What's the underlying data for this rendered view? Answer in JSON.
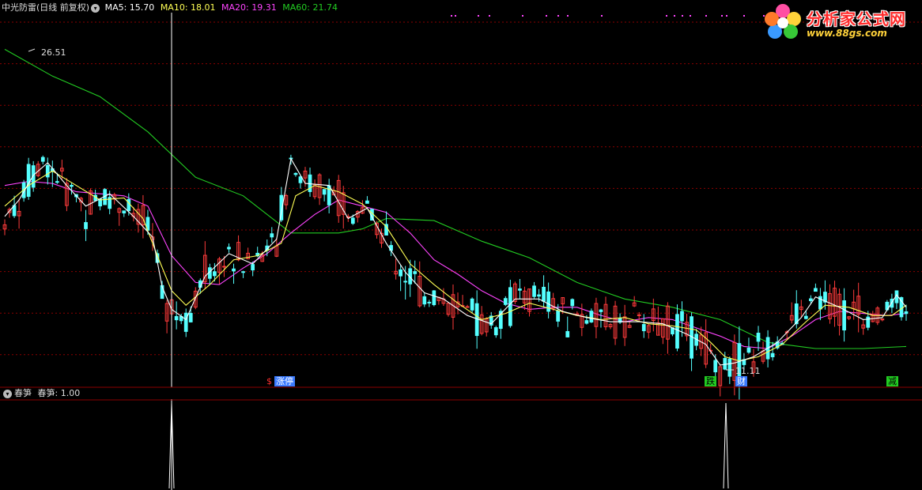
{
  "header": {
    "title": "中光防雷(日线 前复权)",
    "ma5": "MA5: 15.70",
    "ma10": "MA10: 18.01",
    "ma20": "MA20: 19.31",
    "ma60": "MA60: 21.74"
  },
  "sub_header": {
    "indicator": "春笋",
    "value": "春笋: 1.00"
  },
  "logo": {
    "name": "分析家公式网",
    "url": "www.88gs.com"
  },
  "annotations": {
    "high": "26.51",
    "low": "11.11"
  },
  "signals": [
    {
      "label": "$",
      "color": "#ff3030",
      "text_color": "#ff3030"
    },
    {
      "label": "涨停",
      "color": "#3a7aff",
      "text_color": "#ffffff"
    },
    {
      "label": "跌",
      "color": "#22cc22",
      "text_color": "#000000"
    },
    {
      "label": "财",
      "color": "#3a7aff",
      "text_color": "#ffffff"
    },
    {
      "label": "减",
      "color": "#22cc22",
      "text_color": "#000000"
    }
  ],
  "colors": {
    "up": "#ff3b3b",
    "down": "#54ffff",
    "ma5": "#ffffff",
    "ma10": "#ffff55",
    "ma20": "#ff44ff",
    "ma60": "#22cc22",
    "grid": "#8b0000"
  },
  "chart_data": {
    "type": "line",
    "ylim": [
      10.2,
      28.2
    ],
    "candle_count": 190,
    "ma_lines": {
      "MA5": [
        [
          0,
          18.4
        ],
        [
          3,
          19.2
        ],
        [
          6,
          20.4
        ],
        [
          9,
          21.0
        ],
        [
          13,
          19.9
        ],
        [
          17,
          18.9
        ],
        [
          22,
          19.5
        ],
        [
          27,
          18.4
        ],
        [
          31,
          17.4
        ],
        [
          33,
          15.0
        ],
        [
          35,
          13.9
        ],
        [
          38,
          13.4
        ],
        [
          42,
          15.5
        ],
        [
          47,
          16.6
        ],
        [
          52,
          16.1
        ],
        [
          57,
          17.3
        ],
        [
          60,
          21.2
        ],
        [
          63,
          20.0
        ],
        [
          68,
          19.9
        ],
        [
          72,
          18.3
        ],
        [
          76,
          18.8
        ],
        [
          80,
          17.1
        ],
        [
          84,
          15.7
        ],
        [
          88,
          14.7
        ],
        [
          92,
          14.4
        ],
        [
          97,
          13.6
        ],
        [
          102,
          13.2
        ],
        [
          107,
          14.4
        ],
        [
          112,
          14.4
        ],
        [
          117,
          13.8
        ],
        [
          122,
          13.5
        ],
        [
          127,
          13.3
        ],
        [
          133,
          13.3
        ],
        [
          138,
          13.2
        ],
        [
          143,
          12.7
        ],
        [
          147,
          12.2
        ],
        [
          150,
          11.2
        ],
        [
          153,
          11.3
        ],
        [
          157,
          11.6
        ],
        [
          162,
          12.3
        ],
        [
          167,
          13.5
        ],
        [
          170,
          14.5
        ],
        [
          175,
          14.0
        ],
        [
          180,
          13.4
        ],
        [
          184,
          13.5
        ],
        [
          187,
          14.6
        ],
        [
          189,
          14.0
        ]
      ],
      "MA10": [
        [
          0,
          18.9
        ],
        [
          5,
          19.9
        ],
        [
          10,
          20.6
        ],
        [
          15,
          19.9
        ],
        [
          20,
          19.2
        ],
        [
          25,
          19.3
        ],
        [
          29,
          18.3
        ],
        [
          32,
          16.5
        ],
        [
          35,
          14.8
        ],
        [
          38,
          14.1
        ],
        [
          43,
          15.1
        ],
        [
          48,
          16.3
        ],
        [
          53,
          16.5
        ],
        [
          58,
          17.1
        ],
        [
          61,
          19.4
        ],
        [
          65,
          19.9
        ],
        [
          70,
          19.6
        ],
        [
          75,
          19.0
        ],
        [
          80,
          17.9
        ],
        [
          85,
          16.1
        ],
        [
          90,
          15.1
        ],
        [
          95,
          14.2
        ],
        [
          100,
          13.4
        ],
        [
          105,
          13.7
        ],
        [
          110,
          14.2
        ],
        [
          115,
          13.9
        ],
        [
          120,
          13.6
        ],
        [
          125,
          13.4
        ],
        [
          130,
          13.5
        ],
        [
          135,
          13.2
        ],
        [
          140,
          13.1
        ],
        [
          145,
          12.9
        ],
        [
          148,
          12.3
        ],
        [
          151,
          11.6
        ],
        [
          154,
          11.4
        ],
        [
          158,
          11.6
        ],
        [
          163,
          12.2
        ],
        [
          168,
          13.3
        ],
        [
          172,
          14.1
        ],
        [
          177,
          14.0
        ],
        [
          182,
          13.6
        ],
        [
          186,
          13.6
        ],
        [
          189,
          14.1
        ]
      ],
      "MA20": [
        [
          0,
          19.9
        ],
        [
          5,
          20.1
        ],
        [
          10,
          20.0
        ],
        [
          15,
          19.6
        ],
        [
          20,
          19.5
        ],
        [
          25,
          19.4
        ],
        [
          30,
          18.9
        ],
        [
          35,
          16.5
        ],
        [
          40,
          15.2
        ],
        [
          45,
          15.1
        ],
        [
          50,
          15.9
        ],
        [
          55,
          16.6
        ],
        [
          60,
          17.6
        ],
        [
          65,
          18.5
        ],
        [
          70,
          19.2
        ],
        [
          75,
          18.9
        ],
        [
          80,
          18.6
        ],
        [
          85,
          17.6
        ],
        [
          90,
          16.3
        ],
        [
          95,
          15.6
        ],
        [
          100,
          14.8
        ],
        [
          105,
          14.2
        ],
        [
          110,
          13.9
        ],
        [
          115,
          14.0
        ],
        [
          120,
          14.0
        ],
        [
          125,
          13.6
        ],
        [
          130,
          13.3
        ],
        [
          135,
          13.5
        ],
        [
          140,
          13.4
        ],
        [
          145,
          13.0
        ],
        [
          150,
          12.6
        ],
        [
          155,
          12.1
        ],
        [
          160,
          12.0
        ],
        [
          165,
          12.6
        ],
        [
          170,
          13.4
        ],
        [
          175,
          13.8
        ],
        [
          180,
          13.7
        ],
        [
          185,
          13.6
        ],
        [
          189,
          13.7
        ]
      ],
      "MA60": [
        [
          0,
          26.5
        ],
        [
          10,
          25.2
        ],
        [
          20,
          24.2
        ],
        [
          30,
          22.5
        ],
        [
          40,
          20.3
        ],
        [
          50,
          19.4
        ],
        [
          60,
          17.6
        ],
        [
          70,
          17.6
        ],
        [
          75,
          17.8
        ],
        [
          80,
          18.3
        ],
        [
          90,
          18.2
        ],
        [
          100,
          17.2
        ],
        [
          110,
          16.4
        ],
        [
          120,
          15.2
        ],
        [
          130,
          14.4
        ],
        [
          140,
          14.0
        ],
        [
          150,
          13.4
        ],
        [
          160,
          12.3
        ],
        [
          170,
          12.0
        ],
        [
          180,
          12.0
        ],
        [
          189,
          12.1
        ]
      ]
    },
    "signal_spikes": [
      35,
      151
    ],
    "spike_value": 1.0
  }
}
